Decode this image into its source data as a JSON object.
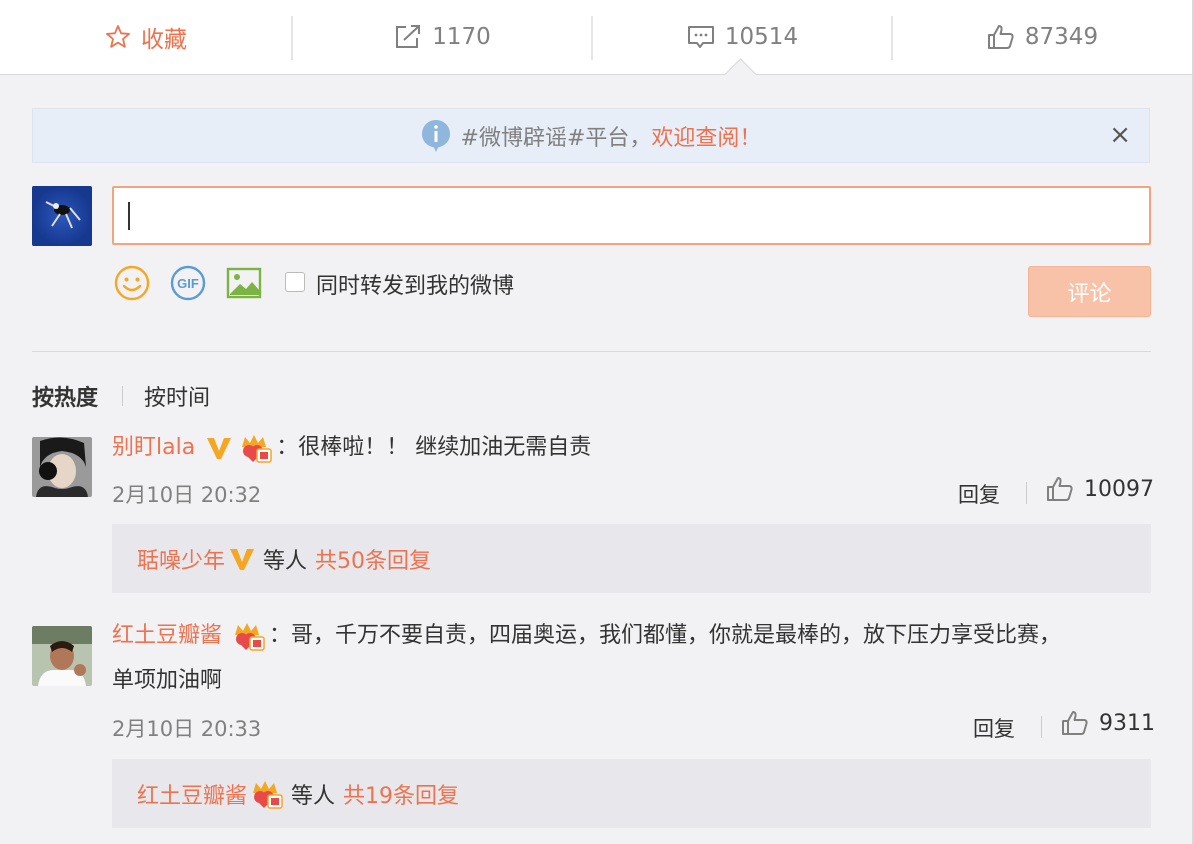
{
  "toolbar": {
    "favorite_label": "收藏",
    "forward_count": "1170",
    "comment_count": "10514",
    "like_count": "87349"
  },
  "notice": {
    "text": "#微博辟谣#平台，",
    "link": "欢迎查阅！",
    "close": "×"
  },
  "composer": {
    "sync_label": "同时转发到我的微博",
    "submit_label": "评论",
    "gif_label": "GIF"
  },
  "sort": {
    "hot": "按热度",
    "time": "按时间"
  },
  "comments": [
    {
      "nick": "别盯lala",
      "text": "：很棒啦！！ 继续加油无需自责",
      "time": "2月10日 20:32",
      "reply_label": "回复",
      "likes": "10097",
      "sub_nick": "聒噪少年",
      "sub_mid": "等人",
      "sub_count": "共50条回复"
    },
    {
      "nick": "红土豆瓣酱",
      "text": "：哥，千万不要自责，四届奥运，我们都懂，你就是最棒的，放下压力享受比赛，",
      "text2": "单项加油啊",
      "time": "2月10日 20:33",
      "reply_label": "回复",
      "likes": "9311",
      "sub_nick": "红土豆瓣酱",
      "sub_mid": "等人",
      "sub_count": "共19条回复"
    }
  ],
  "colors": {
    "accent": "#eb7350",
    "vip_gold": "#f5a623"
  }
}
